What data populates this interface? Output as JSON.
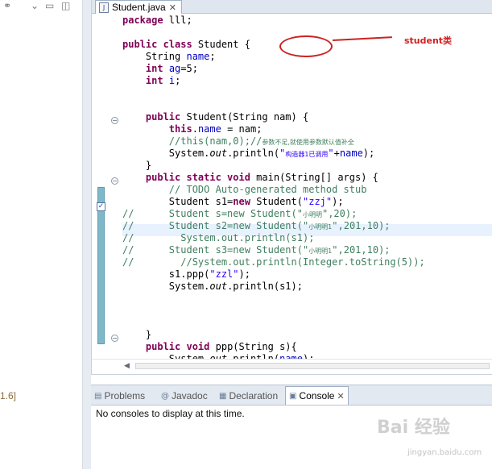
{
  "left_panel": {
    "version_text": "1.6]",
    "toolbar_icons": [
      "link-icon",
      "chevron-down-icon",
      "minimize-icon"
    ]
  },
  "editor": {
    "tab_title": "Student.java",
    "code_lines": [
      {
        "segs": [
          [
            "kw",
            "package"
          ],
          [
            "t",
            " lll;"
          ]
        ]
      },
      {
        "segs": [
          [
            "t",
            ""
          ]
        ]
      },
      {
        "segs": [
          [
            "kw",
            "public class"
          ],
          [
            "t",
            " Student {"
          ]
        ]
      },
      {
        "segs": [
          [
            "t",
            "    String "
          ],
          [
            "fld",
            "name"
          ],
          [
            "t",
            ";"
          ]
        ]
      },
      {
        "segs": [
          [
            "t",
            "    "
          ],
          [
            "kw",
            "int"
          ],
          [
            "t",
            " "
          ],
          [
            "fld",
            "ag"
          ],
          [
            "t",
            "=5;"
          ]
        ]
      },
      {
        "segs": [
          [
            "t",
            "    "
          ],
          [
            "kw",
            "int"
          ],
          [
            "t",
            " "
          ],
          [
            "fld",
            "i"
          ],
          [
            "t",
            ";"
          ]
        ]
      },
      {
        "segs": [
          [
            "t",
            ""
          ]
        ]
      },
      {
        "segs": [
          [
            "t",
            ""
          ]
        ]
      },
      {
        "segs": [
          [
            "t",
            "    "
          ],
          [
            "kw",
            "public"
          ],
          [
            "t",
            " Student(String nam) {"
          ]
        ]
      },
      {
        "segs": [
          [
            "t",
            "        "
          ],
          [
            "kw",
            "this"
          ],
          [
            "t",
            "."
          ],
          [
            "fld",
            "name"
          ],
          [
            "t",
            " = nam;"
          ]
        ]
      },
      {
        "segs": [
          [
            "com",
            "        //this(nam,0);//"
          ],
          [
            "cn",
            "参数不足,就使用参数默认值补全"
          ]
        ]
      },
      {
        "segs": [
          [
            "t",
            "        System."
          ],
          [
            "it",
            "out"
          ],
          [
            "t",
            ".println("
          ],
          [
            "str",
            "\""
          ],
          [
            "cs",
            "构造器1已调用"
          ],
          [
            "str",
            "\""
          ],
          [
            "t",
            "+"
          ],
          [
            "fld",
            "name"
          ],
          [
            "t",
            ");"
          ]
        ]
      },
      {
        "segs": [
          [
            "t",
            "    }"
          ]
        ]
      },
      {
        "segs": [
          [
            "t",
            "    "
          ],
          [
            "kw",
            "public static void"
          ],
          [
            "t",
            " main(String[] args) {"
          ]
        ]
      },
      {
        "segs": [
          [
            "com",
            "        // TODO Auto-generated method stub"
          ]
        ]
      },
      {
        "segs": [
          [
            "t",
            "        Student s1="
          ],
          [
            "kw",
            "new"
          ],
          [
            "t",
            " Student("
          ],
          [
            "str",
            "\"zzj\""
          ],
          [
            "t",
            ");"
          ]
        ]
      },
      {
        "segs": [
          [
            "com",
            "//      Student s=new Student(\""
          ],
          [
            "cn",
            "小明明"
          ],
          [
            "com",
            "\",20);"
          ]
        ]
      },
      {
        "segs": [
          [
            "com",
            "//      Student s2=new Student(\""
          ],
          [
            "cn",
            "小明明1"
          ],
          [
            "com",
            "\",201,10);"
          ]
        ]
      },
      {
        "segs": [
          [
            "com",
            "//        System.out.println(s1);"
          ]
        ]
      },
      {
        "segs": [
          [
            "com",
            "//      Student s3=new Student(\""
          ],
          [
            "cn",
            "小明明1"
          ],
          [
            "com",
            "\",201,10);"
          ]
        ]
      },
      {
        "segs": [
          [
            "com",
            "//        //System.out.println(Integer.toString(5));"
          ]
        ]
      },
      {
        "segs": [
          [
            "t",
            "        s1.ppp("
          ],
          [
            "str",
            "\"zzl\""
          ],
          [
            "t",
            ");"
          ]
        ]
      },
      {
        "segs": [
          [
            "t",
            "        System."
          ],
          [
            "it",
            "out"
          ],
          [
            "t",
            ".println(s1);"
          ]
        ]
      },
      {
        "segs": [
          [
            "t",
            ""
          ]
        ]
      },
      {
        "segs": [
          [
            "t",
            ""
          ]
        ]
      },
      {
        "segs": [
          [
            "t",
            ""
          ]
        ]
      },
      {
        "segs": [
          [
            "t",
            "    }"
          ]
        ]
      },
      {
        "segs": [
          [
            "t",
            "    "
          ],
          [
            "kw",
            "public void"
          ],
          [
            "t",
            " ppp(String s){"
          ]
        ]
      },
      {
        "segs": [
          [
            "t",
            "        System."
          ],
          [
            "it",
            "out"
          ],
          [
            "t",
            ".println("
          ],
          [
            "fld",
            "name"
          ],
          [
            "t",
            ");"
          ]
        ]
      }
    ],
    "annotation_label": "student类"
  },
  "bottom_panel": {
    "tabs": [
      {
        "label": "Problems",
        "icon": "problems-icon"
      },
      {
        "label": "Javadoc",
        "icon": "at-icon"
      },
      {
        "label": "Declaration",
        "icon": "declaration-icon"
      },
      {
        "label": "Console",
        "icon": "console-icon",
        "active": true
      }
    ],
    "console_message": "No consoles to display at this time."
  },
  "watermark": {
    "text": "Bai 经验",
    "sub": "jingyan.baidu.com"
  },
  "colors": {
    "keyword": "#7f0055",
    "field": "#0000c0",
    "string": "#2a00ff",
    "comment": "#3f7f5f",
    "annotation": "#cc2222",
    "change_bar": "#7fb9c9",
    "current_line": "#e8f2fe"
  }
}
